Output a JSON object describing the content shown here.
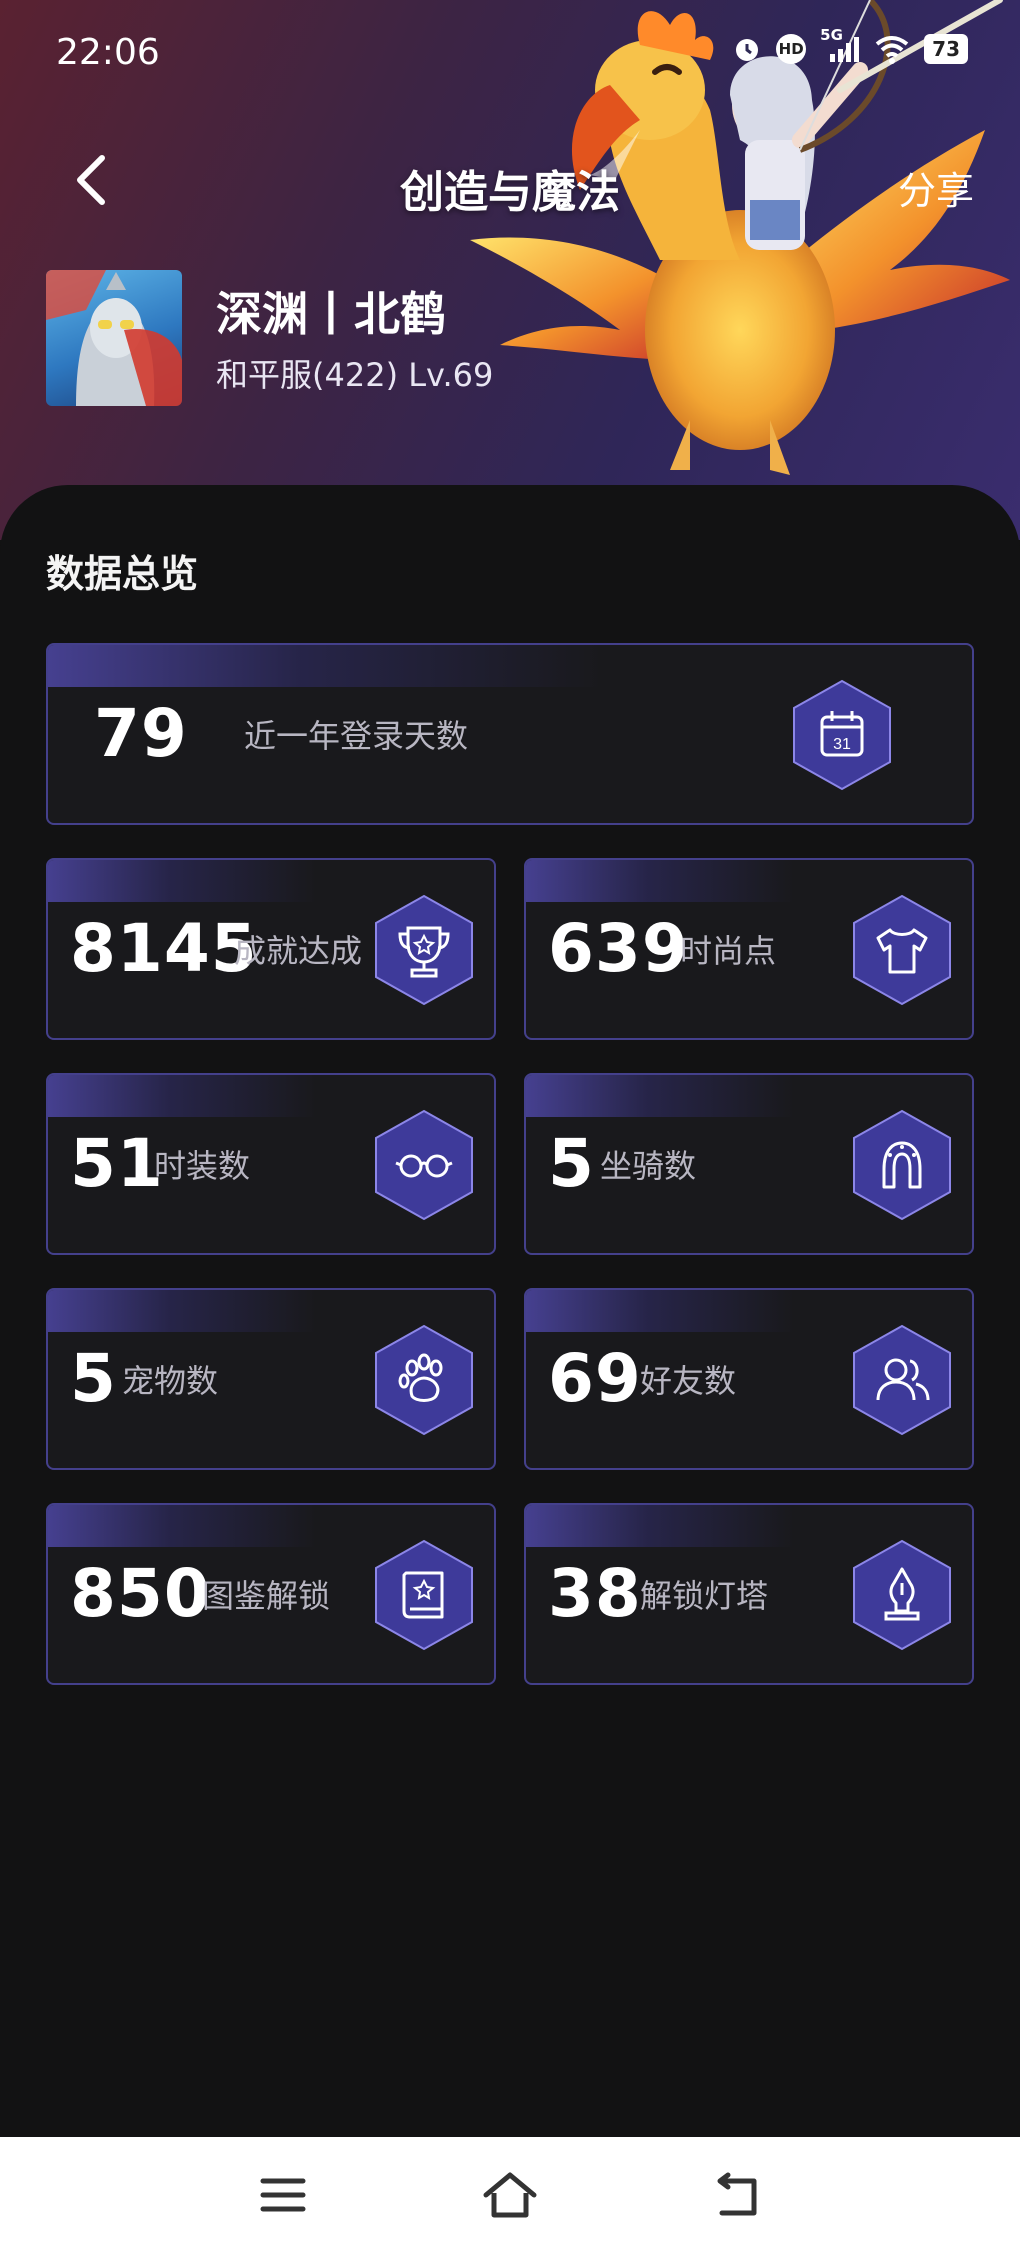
{
  "status_bar": {
    "time": "22:06",
    "network": "5G",
    "hd_badge": "HD",
    "battery": "73",
    "icons": [
      "alarm-icon",
      "hd-icon",
      "signal-icon",
      "wifi-icon",
      "battery-icon"
    ]
  },
  "header": {
    "title": "创造与魔法",
    "share_label": "分享",
    "back_icon": "back-chevron-icon"
  },
  "player": {
    "name": "深渊丨北鹤",
    "server_level": "和平服(422) Lv.69"
  },
  "overview": {
    "title": "数据总览",
    "login_days": {
      "value": "79",
      "label": "近一年登录天数",
      "icon": "calendar-icon",
      "icon_text": "31"
    },
    "stats": [
      {
        "value": "8145",
        "label": "成就达成",
        "icon": "trophy-icon"
      },
      {
        "value": "639",
        "label": "时尚点",
        "icon": "tshirt-icon"
      },
      {
        "value": "51",
        "label": "时装数",
        "icon": "glasses-icon"
      },
      {
        "value": "5",
        "label": "坐骑数",
        "icon": "horseshoe-icon"
      },
      {
        "value": "5",
        "label": "宠物数",
        "icon": "paw-icon"
      },
      {
        "value": "69",
        "label": "好友数",
        "icon": "friends-icon"
      },
      {
        "value": "850",
        "label": "图鉴解锁",
        "icon": "book-icon"
      },
      {
        "value": "38",
        "label": "解锁灯塔",
        "icon": "lighthouse-icon"
      }
    ]
  },
  "navbar": {
    "buttons": [
      "menu-icon",
      "home-icon",
      "back-icon"
    ]
  },
  "colors": {
    "background": "#121213",
    "card": "#19191c",
    "card_border": "#44408c",
    "hex_fill": "#3e3a9a",
    "hero_start": "#5a2231",
    "hero_end": "#3a2d6e"
  }
}
